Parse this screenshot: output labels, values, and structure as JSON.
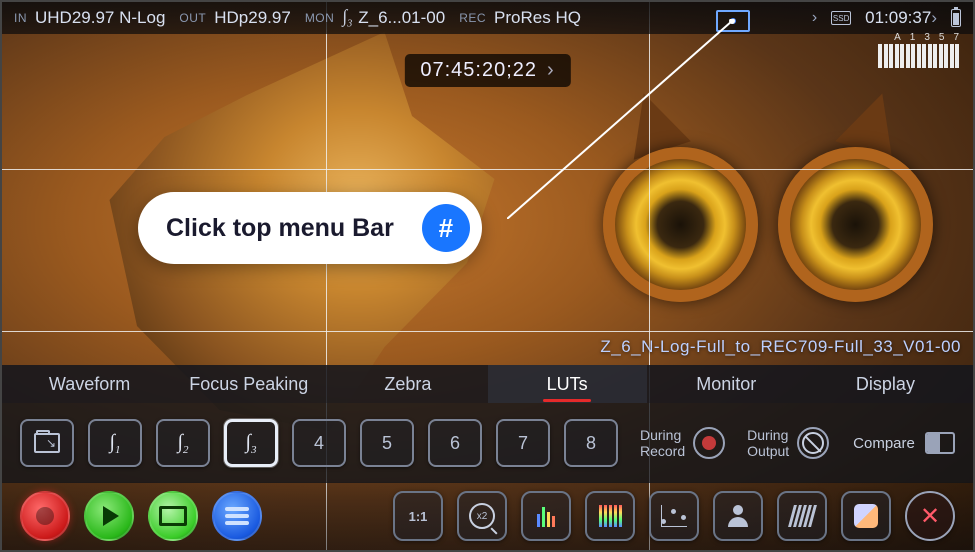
{
  "top": {
    "in_label": "IN",
    "in_value": "UHD29.97  N-Log",
    "out_label": "OUT",
    "out_value": "HDp29.97",
    "mon_label": "MON",
    "mon_value": "Z_6...01-00",
    "rec_label": "REC",
    "rec_value": "ProRes HQ",
    "disk_icon": "SSD",
    "clock": "01:09:37",
    "audio_channels": [
      "A",
      "1",
      "3",
      "5",
      "7"
    ]
  },
  "timecode": {
    "value": "07:45:20;22",
    "chev": "›"
  },
  "tooltip": {
    "text": "Click top menu Bar",
    "badge": "#"
  },
  "lut_overlay": "Z_6_N-Log-Full_to_REC709-Full_33_V01-00",
  "tabs": [
    "Waveform",
    "Focus Peaking",
    "Zebra",
    "LUTs",
    "Monitor",
    "Display"
  ],
  "tabs_active_index": 3,
  "lut": {
    "slots": [
      "1",
      "2",
      "3"
    ],
    "selected_slot_index": 2,
    "numbers": [
      "4",
      "5",
      "6",
      "7",
      "8"
    ],
    "during_record": "During\nRecord",
    "during_output": "During\nOutput",
    "compare": "Compare"
  },
  "bottom": {
    "ratio": "1:1",
    "zoom": "x2"
  }
}
